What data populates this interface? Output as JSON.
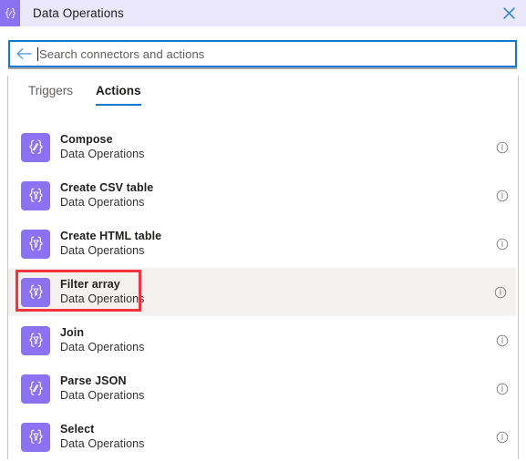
{
  "header": {
    "icon": "data-operations-braces-icon",
    "title": "Data Operations",
    "close_label": "✕",
    "bg_color": "#ebe7fb",
    "icon_color": "#8b72f0",
    "close_color": "#2b88d8"
  },
  "search": {
    "back_icon": "back-arrow-icon",
    "placeholder": "Search connectors and actions",
    "value": "",
    "border_color": "#0f78d4"
  },
  "tabs": [
    {
      "label": "Triggers",
      "active": false
    },
    {
      "label": "Actions",
      "active": true
    }
  ],
  "tab_accent_color": "#0f78d4",
  "list": {
    "items": [
      {
        "title": "Compose",
        "subtitle": "Data Operations",
        "icon": "braces-pencil-icon",
        "info_icon": "info-icon",
        "hover": false
      },
      {
        "title": "Create CSV table",
        "subtitle": "Data Operations",
        "icon": "braces-funnel-icon",
        "info_icon": "info-icon",
        "hover": false
      },
      {
        "title": "Create HTML table",
        "subtitle": "Data Operations",
        "icon": "braces-funnel-icon",
        "info_icon": "info-icon",
        "hover": false
      },
      {
        "title": "Filter array",
        "subtitle": "Data Operations",
        "icon": "braces-funnel-icon",
        "info_icon": "info-icon",
        "hover": true
      },
      {
        "title": "Join",
        "subtitle": "Data Operations",
        "icon": "braces-funnel-icon",
        "info_icon": "info-icon",
        "hover": false
      },
      {
        "title": "Parse JSON",
        "subtitle": "Data Operations",
        "icon": "braces-pencil-icon",
        "info_icon": "info-icon",
        "hover": false
      },
      {
        "title": "Select",
        "subtitle": "Data Operations",
        "icon": "braces-funnel-icon",
        "info_icon": "info-icon",
        "hover": false
      }
    ],
    "icon_bg_color": "#8b72f0",
    "hover_bg_color": "#f3f2f1"
  },
  "annotation": {
    "target": "Filter array",
    "color": "#f5333f"
  }
}
